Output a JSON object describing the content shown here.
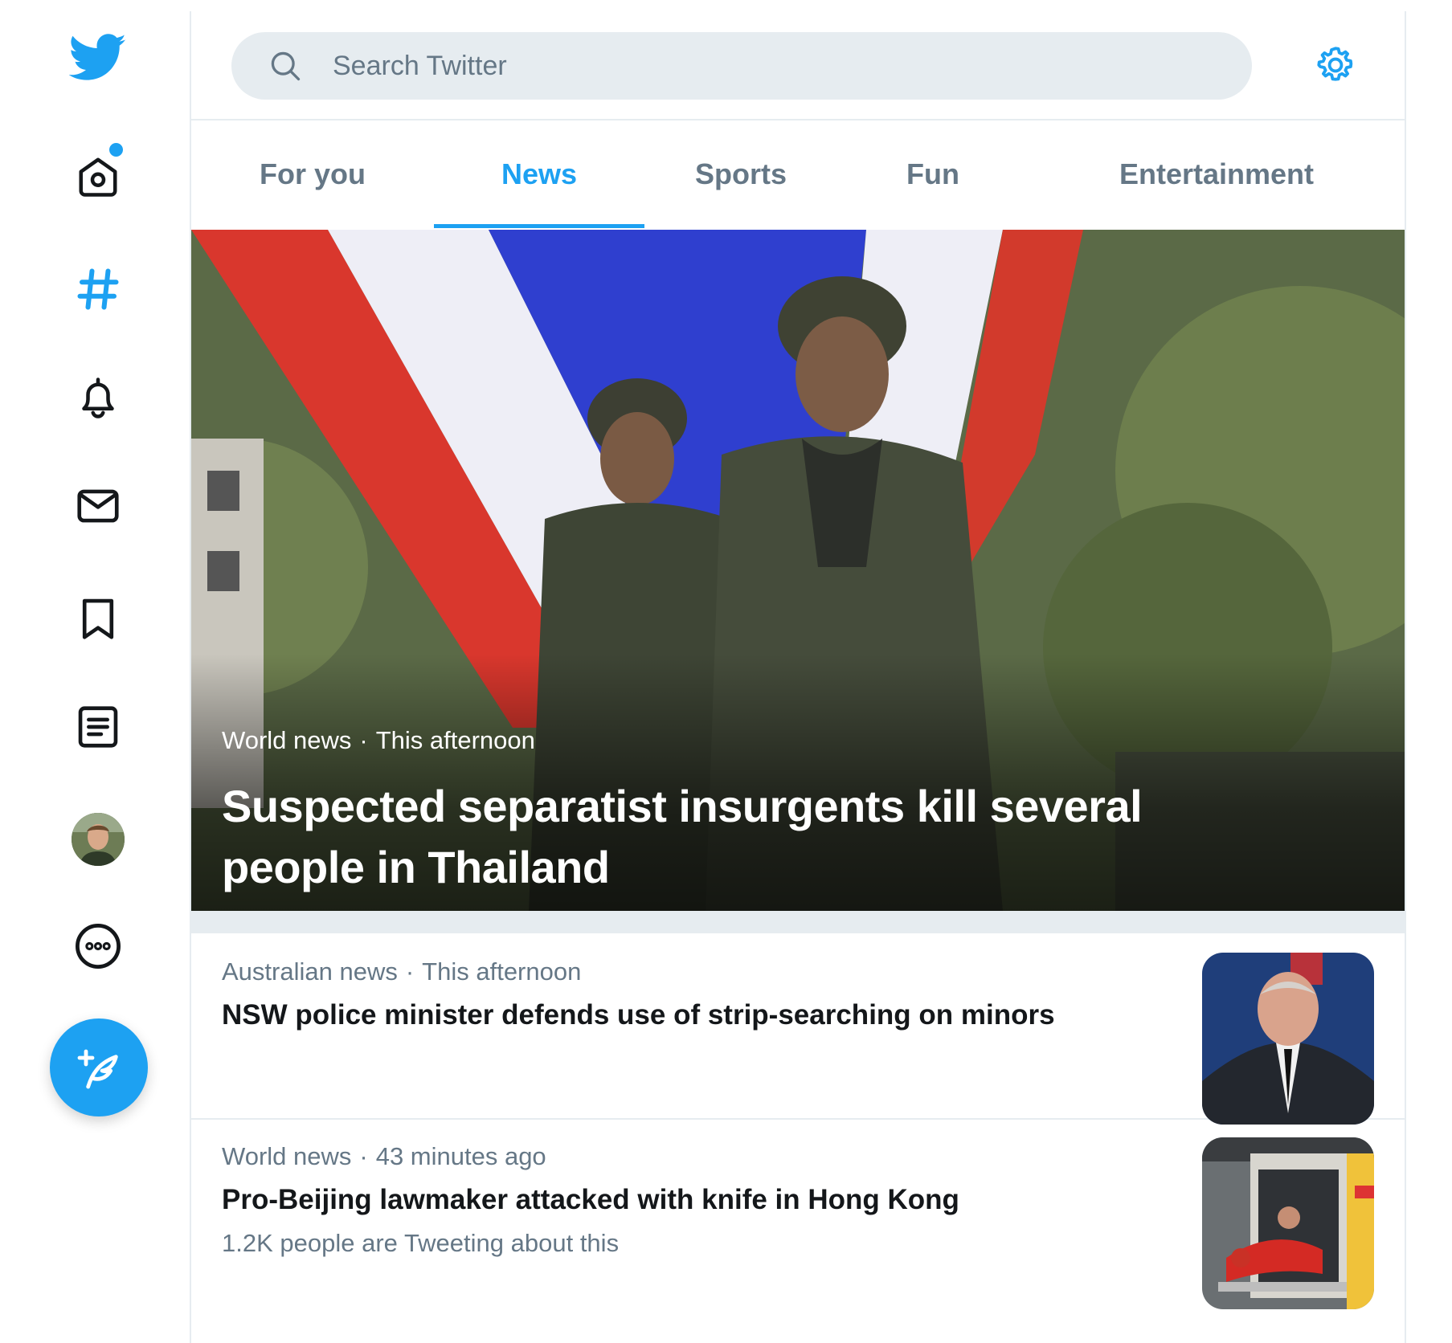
{
  "app": {
    "name": "Twitter"
  },
  "sidebar": {
    "items": [
      {
        "name": "twitter-logo",
        "label": "Twitter"
      },
      {
        "name": "home",
        "label": "Home",
        "has_notification": true
      },
      {
        "name": "explore",
        "label": "Explore",
        "active": true
      },
      {
        "name": "notifications",
        "label": "Notifications"
      },
      {
        "name": "messages",
        "label": "Messages"
      },
      {
        "name": "bookmarks",
        "label": "Bookmarks"
      },
      {
        "name": "lists",
        "label": "Lists"
      },
      {
        "name": "profile",
        "label": "Profile"
      },
      {
        "name": "more",
        "label": "More"
      }
    ],
    "compose_label": "Tweet"
  },
  "search": {
    "placeholder": "Search Twitter",
    "value": ""
  },
  "tabs": [
    {
      "label": "For you",
      "active": false
    },
    {
      "label": "News",
      "active": true
    },
    {
      "label": "Sports",
      "active": false
    },
    {
      "label": "Fun",
      "active": false
    },
    {
      "label": "Entertainment",
      "active": false
    }
  ],
  "hero": {
    "category": "World news",
    "separator": "·",
    "time": "This afternoon",
    "title": "Suspected separatist insurgents kill several people in Thailand"
  },
  "stories": [
    {
      "category": "Australian news",
      "separator": "·",
      "time": "This afternoon",
      "headline": "NSW police minister defends use of strip-searching on minors",
      "sub": ""
    },
    {
      "category": "World news",
      "separator": "·",
      "time": "43 minutes ago",
      "headline": "Pro-Beijing lawmaker attacked with knife in Hong Kong",
      "sub": "1.2K people are Tweeting about this"
    }
  ],
  "colors": {
    "accent": "#1da1f2",
    "text": "#14171a",
    "secondary_text": "#657786",
    "border": "#e6ecf0",
    "search_bg": "#e6ecf0"
  }
}
